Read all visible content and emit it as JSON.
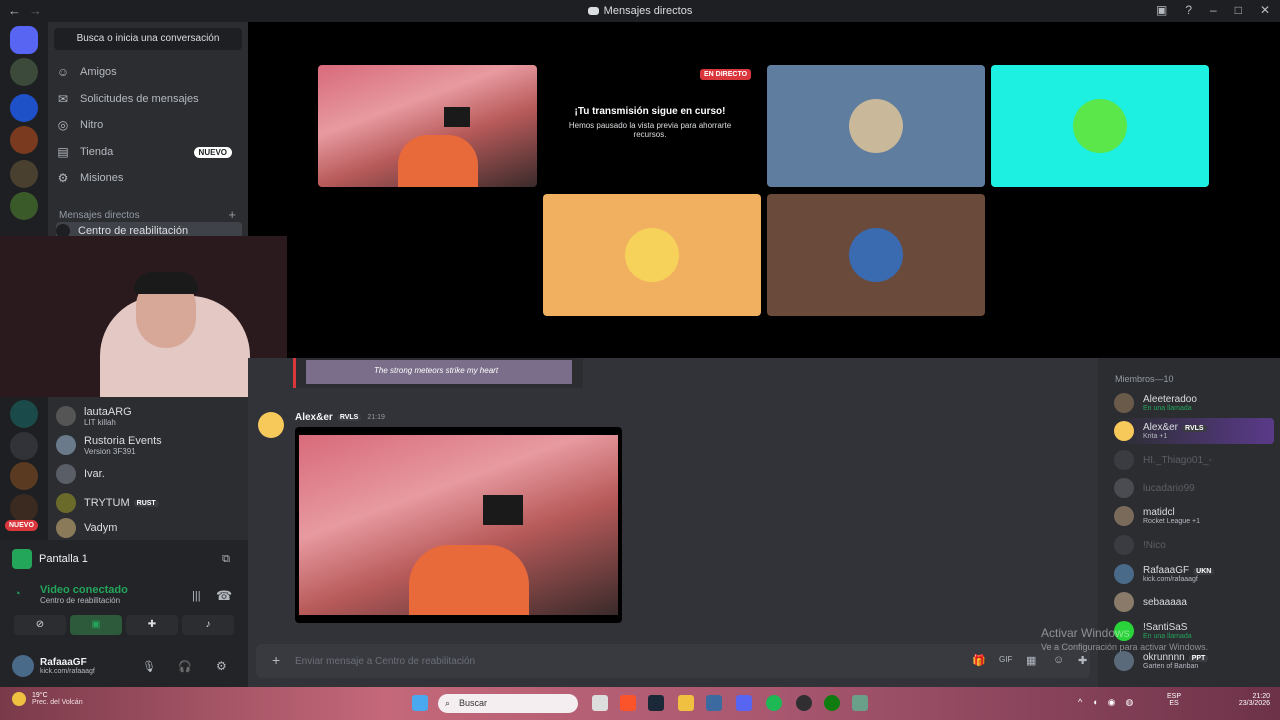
{
  "window": {
    "title": "Mensajes directos"
  },
  "sidebar": {
    "search_label": "Busca o inicia una conversación",
    "nav": [
      {
        "label": "Amigos",
        "icon": "friends-icon"
      },
      {
        "label": "Solicitudes de mensajes",
        "icon": "mail-icon"
      },
      {
        "label": "Nitro",
        "icon": "nitro-icon"
      },
      {
        "label": "Tienda",
        "icon": "shop-icon",
        "badge": "NUEVO"
      },
      {
        "label": "Misiones",
        "icon": "quests-icon"
      }
    ],
    "dm_header": "Mensajes directos",
    "dms": [
      {
        "name": "Centro de reabilitación",
        "sub": ""
      },
      {
        "name": "lautaARG",
        "sub": "LIT killah"
      },
      {
        "name": "Rustoria Events",
        "sub": "Version 3F391"
      },
      {
        "name": "Ivar.",
        "sub": ""
      },
      {
        "name": "TRYTUM",
        "sub": "",
        "tag": "RUST"
      },
      {
        "name": "Vadym",
        "sub": ""
      }
    ]
  },
  "server_badge_new": "NUEVO",
  "voice": {
    "screen_label": "Pantalla 1",
    "status": "Video conectado",
    "channel": "Centro de reabilitación"
  },
  "user": {
    "name": "RafaaaGF",
    "status": "kick.com/rafaaagf"
  },
  "stage": {
    "live_badge": "EN DIRECTO",
    "paused_title": "¡Tu transmisión sigue en curso!",
    "paused_text": "Hemos pausado la vista previa para ahorrarte recursos."
  },
  "chat": {
    "embed_caption": "The strong meteors strike my heart",
    "message": {
      "author": "Alex&er",
      "tag": "RVLS",
      "time": "21:19"
    },
    "input_placeholder": "Enviar mensaje a Centro de reabilitación"
  },
  "members": {
    "header": "Miembros—10",
    "list": [
      {
        "name": "Aleeteradoo",
        "status": "En una llamada",
        "dim": false
      },
      {
        "name": "Alex&er",
        "status": "Krita +1",
        "tag": "RVLS",
        "dim": false
      },
      {
        "name": "HI._Thiago01_-",
        "status": "",
        "dim": true
      },
      {
        "name": "lucadario99",
        "status": "",
        "dim": true
      },
      {
        "name": "matidcl",
        "status": "Rocket League +1",
        "dim": false
      },
      {
        "name": "!Nico",
        "status": "",
        "dim": true
      },
      {
        "name": "RafaaaGF",
        "status": "kick.com/rafaaagf",
        "tag": "UKN",
        "dim": false
      },
      {
        "name": "sebaaaaa",
        "status": "",
        "dim": false
      },
      {
        "name": "!SantiSaS",
        "status": "En una llamada",
        "dim": false
      },
      {
        "name": "okrunnnn",
        "status": "Garten of Banban",
        "tag": "PPT",
        "dim": false
      }
    ]
  },
  "watermark": {
    "line1": "Activar Windows",
    "line2": "Ve a Configuración para activar Windows."
  },
  "taskbar": {
    "weather": "19°C",
    "weather_sub": "Prec. del Volcán",
    "search": "Buscar",
    "lang": "ESP",
    "lang2": "ES",
    "time": "21:20",
    "date": "23/3/2026"
  },
  "colors": {
    "accent": "#5865f2",
    "green": "#23a55a",
    "live": "#da373c"
  }
}
